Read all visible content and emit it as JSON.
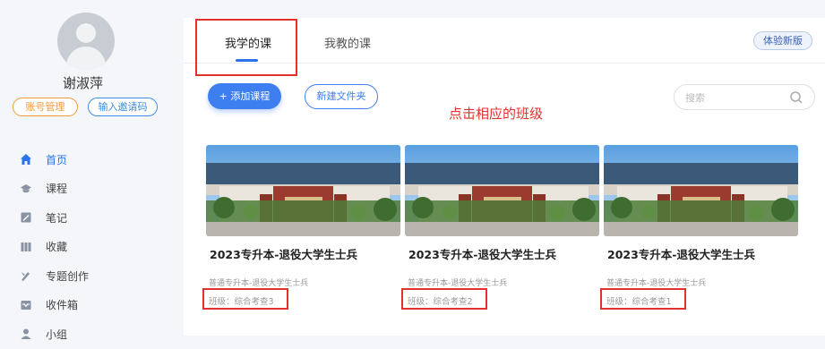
{
  "sidebar": {
    "user_name": "谢淑萍",
    "account_btn": "账号管理",
    "invite_btn": "输入邀请码",
    "nav": [
      {
        "label": "首页",
        "icon": "home-icon",
        "active": true
      },
      {
        "label": "课程",
        "icon": "course-icon",
        "active": false
      },
      {
        "label": "笔记",
        "icon": "note-icon",
        "active": false
      },
      {
        "label": "收藏",
        "icon": "bookmark-icon",
        "active": false
      },
      {
        "label": "专题创作",
        "icon": "creation-icon",
        "active": false
      },
      {
        "label": "收件箱",
        "icon": "inbox-icon",
        "active": false
      },
      {
        "label": "小组",
        "icon": "group-icon",
        "active": false
      }
    ]
  },
  "tabs": {
    "learn": "我学的课",
    "teach": "我教的课",
    "new_version": "体验新版"
  },
  "toolbar": {
    "add_course": "+ 添加课程",
    "new_folder": "新建文件夹",
    "search_placeholder": "搜索"
  },
  "hint": "点击相应的班级",
  "courses": [
    {
      "title": "2023专升本-退役大学生士兵",
      "subtitle": "普通专升本-退役大学生士兵",
      "class": "班级：综合考查3"
    },
    {
      "title": "2023专升本-退役大学生士兵",
      "subtitle": "普通专升本-退役大学生士兵",
      "class": "班级：综合考查2"
    },
    {
      "title": "2023专升本-退役大学生士兵",
      "subtitle": "普通专升本-退役大学生士兵",
      "class": "班级：综合考查1"
    }
  ],
  "colors": {
    "accent": "#3d7ef0",
    "annotation_red": "#e0312c",
    "account_orange": "#f29b3c"
  }
}
